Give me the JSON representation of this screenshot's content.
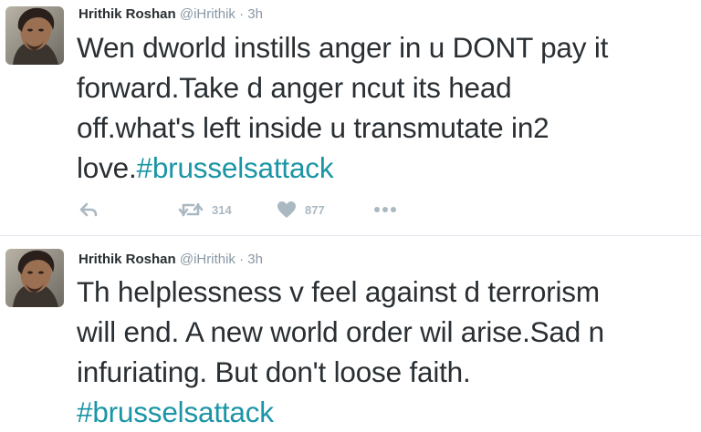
{
  "colors": {
    "text": "#292f33",
    "muted": "#8899a6",
    "hashtag": "#1b95a6",
    "action": "#aab8c2",
    "divider": "#e1e8ed"
  },
  "tweets": [
    {
      "author": {
        "name": "Hrithik Roshan",
        "handle": "@iHrithik"
      },
      "separator": "·",
      "time": "3h",
      "text": "Wen dworld instills anger in u DONT pay it\nforward.Take d anger ncut its head\noff.what's left inside u transmutate in2\nlove.",
      "hashtag": "#brusselsattack",
      "actions": {
        "reply_icon": "reply-icon",
        "retweet_icon": "retweet-icon",
        "retweets": "314",
        "like_icon": "heart-icon",
        "likes": "877",
        "more_icon": "more-dots-icon"
      }
    },
    {
      "author": {
        "name": "Hrithik Roshan",
        "handle": "@iHrithik"
      },
      "separator": "·",
      "time": "3h",
      "text": "Th helplessness v feel against d terrorism\nwill end. A new world order wil arise.Sad n\ninfuriating. But don't loose faith.\n",
      "hashtag": "#brusselsattack"
    }
  ]
}
